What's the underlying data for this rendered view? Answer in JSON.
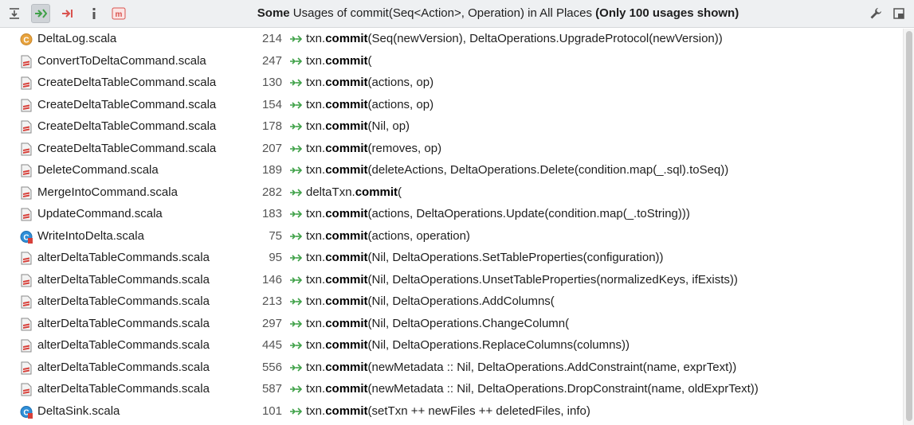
{
  "header": {
    "title_bold_prefix": "Some",
    "title_middle": " Usages of commit(Seq<Action>, Operation) in All Places ",
    "title_bold_suffix": "(Only 100 usages shown)",
    "icons": [
      "merge-usages-icon",
      "navigate-next-usage-icon",
      "navigate-prev-usage-icon",
      "info-icon",
      "method-icon",
      "settings-wrench-icon",
      "pin-window-icon"
    ]
  },
  "colors": {
    "accent_green": "#3fa148",
    "accent_red": "#d9534f",
    "scala_red": "#d7403a",
    "class_orange": "#e8a33d",
    "object_blue": "#2f8fd8"
  },
  "rows": [
    {
      "file": "DeltaLog.scala",
      "icon": "scala-class-icon",
      "line": "214",
      "pre": "txn.",
      "method": "commit",
      "post": "(Seq(newVersion), DeltaOperations.UpgradeProtocol(newVersion))"
    },
    {
      "file": "ConvertToDeltaCommand.scala",
      "icon": "scala-file-icon",
      "line": "247",
      "pre": "txn.",
      "method": "commit",
      "post": "("
    },
    {
      "file": "CreateDeltaTableCommand.scala",
      "icon": "scala-file-icon",
      "line": "130",
      "pre": "txn.",
      "method": "commit",
      "post": "(actions, op)"
    },
    {
      "file": "CreateDeltaTableCommand.scala",
      "icon": "scala-file-icon",
      "line": "154",
      "pre": "txn.",
      "method": "commit",
      "post": "(actions, op)"
    },
    {
      "file": "CreateDeltaTableCommand.scala",
      "icon": "scala-file-icon",
      "line": "178",
      "pre": "txn.",
      "method": "commit",
      "post": "(Nil, op)"
    },
    {
      "file": "CreateDeltaTableCommand.scala",
      "icon": "scala-file-icon",
      "line": "207",
      "pre": "txn.",
      "method": "commit",
      "post": "(removes, op)"
    },
    {
      "file": "DeleteCommand.scala",
      "icon": "scala-file-icon",
      "line": "189",
      "pre": "txn.",
      "method": "commit",
      "post": "(deleteActions, DeltaOperations.Delete(condition.map(_.sql).toSeq))"
    },
    {
      "file": "MergeIntoCommand.scala",
      "icon": "scala-file-icon",
      "line": "282",
      "pre": "deltaTxn.",
      "method": "commit",
      "post": "("
    },
    {
      "file": "UpdateCommand.scala",
      "icon": "scala-file-icon",
      "line": "183",
      "pre": "txn.",
      "method": "commit",
      "post": "(actions, DeltaOperations.Update(condition.map(_.toString)))"
    },
    {
      "file": "WriteIntoDelta.scala",
      "icon": "scala-case-class-icon",
      "line": "75",
      "pre": "txn.",
      "method": "commit",
      "post": "(actions, operation)"
    },
    {
      "file": "alterDeltaTableCommands.scala",
      "icon": "scala-file-icon",
      "line": "95",
      "pre": "txn.",
      "method": "commit",
      "post": "(Nil, DeltaOperations.SetTableProperties(configuration))"
    },
    {
      "file": "alterDeltaTableCommands.scala",
      "icon": "scala-file-icon",
      "line": "146",
      "pre": "txn.",
      "method": "commit",
      "post": "(Nil, DeltaOperations.UnsetTableProperties(normalizedKeys, ifExists))"
    },
    {
      "file": "alterDeltaTableCommands.scala",
      "icon": "scala-file-icon",
      "line": "213",
      "pre": "txn.",
      "method": "commit",
      "post": "(Nil, DeltaOperations.AddColumns("
    },
    {
      "file": "alterDeltaTableCommands.scala",
      "icon": "scala-file-icon",
      "line": "297",
      "pre": "txn.",
      "method": "commit",
      "post": "(Nil, DeltaOperations.ChangeColumn("
    },
    {
      "file": "alterDeltaTableCommands.scala",
      "icon": "scala-file-icon",
      "line": "445",
      "pre": "txn.",
      "method": "commit",
      "post": "(Nil, DeltaOperations.ReplaceColumns(columns))"
    },
    {
      "file": "alterDeltaTableCommands.scala",
      "icon": "scala-file-icon",
      "line": "556",
      "pre": "txn.",
      "method": "commit",
      "post": "(newMetadata :: Nil, DeltaOperations.AddConstraint(name, exprText))"
    },
    {
      "file": "alterDeltaTableCommands.scala",
      "icon": "scala-file-icon",
      "line": "587",
      "pre": "txn.",
      "method": "commit",
      "post": "(newMetadata :: Nil, DeltaOperations.DropConstraint(name, oldExprText))"
    },
    {
      "file": "DeltaSink.scala",
      "icon": "scala-case-class-icon",
      "line": "101",
      "pre": "txn.",
      "method": "commit",
      "post": "(setTxn ++ newFiles ++ deletedFiles, info)"
    }
  ]
}
